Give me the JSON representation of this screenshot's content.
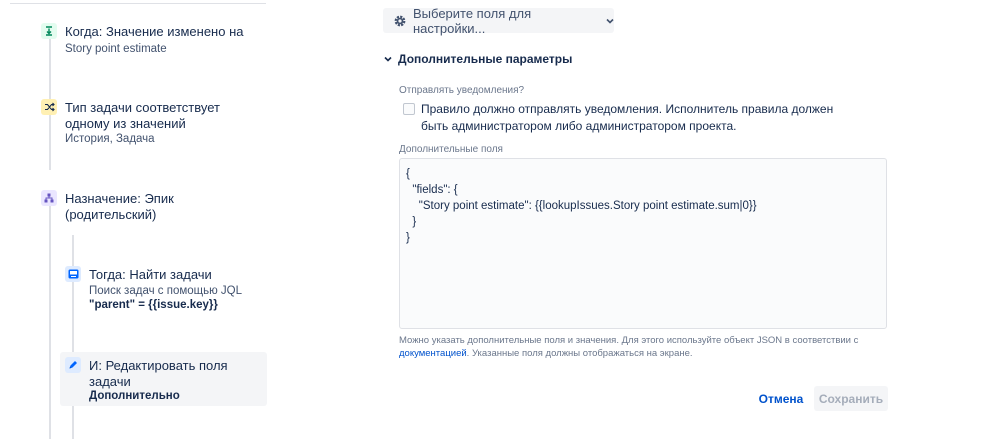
{
  "sidebar": {
    "steps": [
      {
        "title": "Когда: Значение изменено на",
        "sub": "Story point estimate",
        "icon": "trigger-icon",
        "color": "#00875a"
      },
      {
        "title_line1": "Тип задачи соответствует",
        "title_line2": "одному из значений",
        "sub": "История, Задача",
        "icon": "shuffle-icon",
        "color": "#ffab00"
      },
      {
        "title_line1": "Назначение: Эпик",
        "title_line2": "(родительский)",
        "icon": "hierarchy-icon",
        "color": "#6554c0"
      },
      {
        "title": "Тогда: Найти задачи",
        "sub": "Поиск задач с помощью JQL",
        "sub_bold": "\"parent\" = {{issue.key}}",
        "icon": "lookup-icon",
        "color": "#0065ff"
      },
      {
        "title_line1": "И: Редактировать поля",
        "title_line2": "задачи",
        "sub_bold": "Дополнительно",
        "icon": "pencil-icon",
        "color": "#0065ff"
      }
    ]
  },
  "main": {
    "fields_select_label": "Выберите поля для настройки...",
    "section_title": "Дополнительные параметры",
    "notify_label": "Отправлять уведомления?",
    "notify_checkbox_text": "Правило должно отправлять уведомления. Исполнитель правила должен быть администратором либо администратором проекта.",
    "notify_checked": false,
    "additional_fields_label": "Дополнительные поля",
    "additional_fields_value": "{\n  \"fields\": {\n    \"Story point estimate\": {{lookupIssues.Story point estimate.sum|0}}\n  }\n}",
    "help_text_before": "Можно указать дополнительные поля и значения. Для этого используйте объект JSON в соответствии с ",
    "help_link": "документацией",
    "help_text_after": ". Указанные поля должны отображаться на экране.",
    "cancel_label": "Отмена",
    "save_label": "Сохранить"
  },
  "colors": {
    "link": "#0052cc",
    "text": "#172b4d",
    "muted": "#6b778c"
  }
}
